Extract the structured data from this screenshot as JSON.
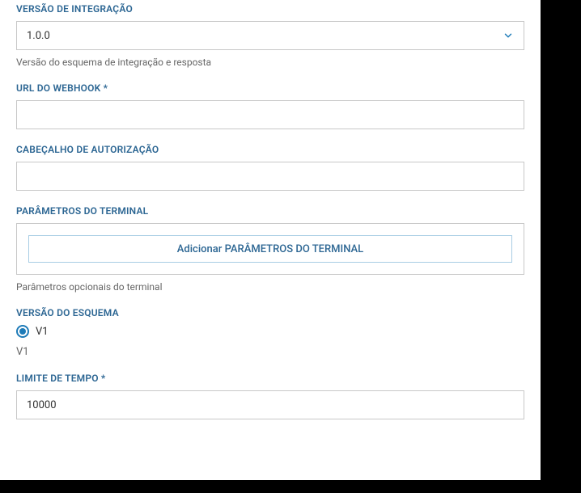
{
  "integrationVersion": {
    "label": "VERSÃO DE INTEGRAÇÃO",
    "value": "1.0.0",
    "helper": "Versão do esquema de integração e resposta"
  },
  "webhookUrl": {
    "label": "URL DO WEBHOOK *",
    "value": ""
  },
  "authHeader": {
    "label": "CABEÇALHO DE AUTORIZAÇÃO",
    "value": ""
  },
  "terminalParams": {
    "label": "PARÂMETROS DO TERMINAL",
    "addButton": "Adicionar PARÂMETROS DO TERMINAL",
    "helper": "Parâmetros opcionais do terminal"
  },
  "schemaVersion": {
    "label": "VERSÃO DO ESQUEMA",
    "optionLabel": "V1",
    "desc": "V1"
  },
  "timeout": {
    "label": "LIMITE DE TEMPO *",
    "value": "10000"
  }
}
